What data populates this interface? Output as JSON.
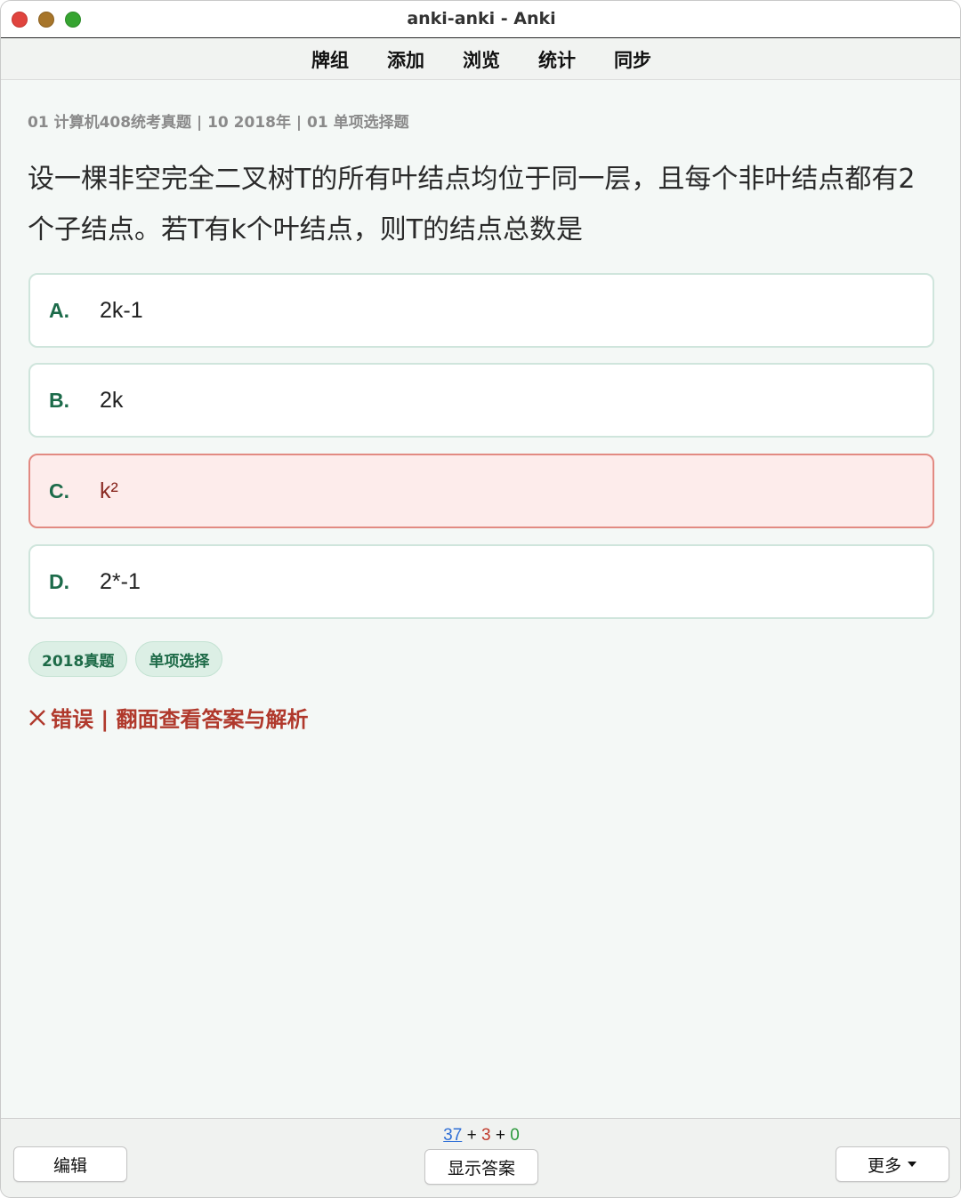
{
  "window": {
    "title": "anki-anki - Anki"
  },
  "topmenu": {
    "items": [
      "牌组",
      "添加",
      "浏览",
      "统计",
      "同步"
    ]
  },
  "card": {
    "breadcrumb": "01 计算机408统考真题 | 10 2018年 | 01 单项选择题",
    "question": "设一棵非空完全二叉树T的所有叶结点均位于同一层，且每个非叶结点都有2个子结点。若T有k个叶结点，则T的结点总数是",
    "options": [
      {
        "letter": "A.",
        "text": "2k-1",
        "state": "normal"
      },
      {
        "letter": "B.",
        "text": "2k",
        "state": "normal"
      },
      {
        "letter": "C.",
        "text": "k²",
        "state": "wrong"
      },
      {
        "letter": "D.",
        "text": "2*-1",
        "state": "normal"
      }
    ],
    "tags": [
      "2018真题",
      "单项选择"
    ],
    "result_icon": "close-x-icon",
    "result_text": "错误 | 翻面查看答案与解析"
  },
  "bottombar": {
    "edit_label": "编辑",
    "show_answer_label": "显示答案",
    "more_label": "更多",
    "more_icon": "caret-down-icon",
    "counts": {
      "new": "37",
      "learning": "3",
      "review": "0",
      "sep": "+"
    }
  },
  "colors": {
    "accent_green": "#1c6b4a",
    "wrong_red": "#b0392c",
    "new_blue": "#2f6fd6",
    "learn_red": "#c0392b",
    "review_green": "#2e9a3e"
  }
}
